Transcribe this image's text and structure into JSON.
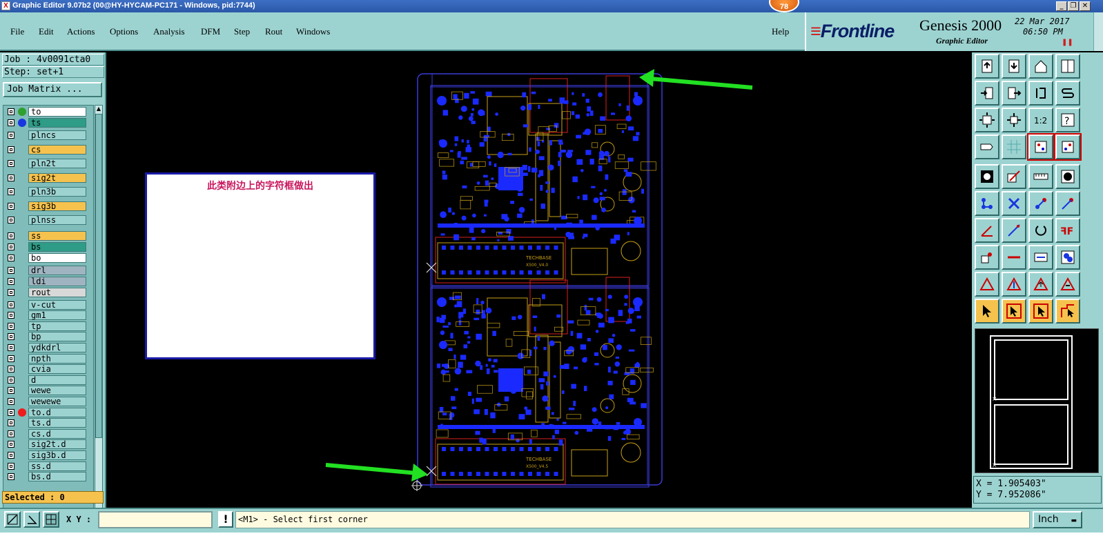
{
  "window": {
    "title": "Graphic Editor 9.07b2 (00@HY-HYCAM-PC171 - Windows, pid:7744)",
    "notification_count": "78",
    "minimize_glyph": "_",
    "restore_glyph": "❐",
    "close_glyph": "✕"
  },
  "menu": {
    "items": [
      "File",
      "Edit",
      "Actions",
      "Options",
      "Analysis",
      "DFM",
      "Step",
      "Rout",
      "Windows"
    ],
    "help": "Help"
  },
  "brand": {
    "logo": "Frontline",
    "product": "Genesis 2000",
    "subtitle": "Graphic Editor",
    "date": "22 Mar 2017",
    "time": "06:50 PM",
    "pause_glyph": "❚❚"
  },
  "info": {
    "job": "Job : 4v0091cta0",
    "step": "Step: set+1",
    "job_matrix": "Job Matrix ...",
    "selected": "Selected : 0"
  },
  "layers": [
    {
      "name": "to",
      "bg": "#ffffff",
      "dot": "#2ea02e"
    },
    {
      "name": "ts",
      "bg": "#2e9c86",
      "dot": "#1836e0"
    },
    {
      "name": "plncs",
      "bg": "#9cd3d1",
      "dot": ""
    },
    {
      "name": "cs",
      "bg": "#f6c24e",
      "dot": ""
    },
    {
      "name": "pln2t",
      "bg": "#9cd3d1",
      "dot": ""
    },
    {
      "name": "sig2t",
      "bg": "#f6c24e",
      "dot": ""
    },
    {
      "name": "pln3b",
      "bg": "#9cd3d1",
      "dot": ""
    },
    {
      "name": "sig3b",
      "bg": "#f6c24e",
      "dot": ""
    },
    {
      "name": "plnss",
      "bg": "#9cd3d1",
      "dot": ""
    },
    {
      "name": "ss",
      "bg": "#f6c24e",
      "dot": ""
    },
    {
      "name": "bs",
      "bg": "#2e9c86",
      "dot": ""
    },
    {
      "name": "bo",
      "bg": "#ffffff",
      "dot": ""
    },
    {
      "name": "drl",
      "bg": "#9fb4c0",
      "dot": ""
    },
    {
      "name": "ldi",
      "bg": "#9fb4c0",
      "dot": ""
    },
    {
      "name": "rout",
      "bg": "#d8d8d8",
      "dot": ""
    },
    {
      "name": "v-cut",
      "bg": "#9cd3d1",
      "dot": ""
    },
    {
      "name": "gm1",
      "bg": "#9cd3d1",
      "dot": ""
    },
    {
      "name": "tp",
      "bg": "#9cd3d1",
      "dot": ""
    },
    {
      "name": "bp",
      "bg": "#9cd3d1",
      "dot": ""
    },
    {
      "name": "ydkdrl",
      "bg": "#9cd3d1",
      "dot": ""
    },
    {
      "name": "npth",
      "bg": "#9cd3d1",
      "dot": ""
    },
    {
      "name": "cvia",
      "bg": "#9cd3d1",
      "dot": ""
    },
    {
      "name": "d",
      "bg": "#9cd3d1",
      "dot": ""
    },
    {
      "name": "wewe",
      "bg": "#9cd3d1",
      "dot": ""
    },
    {
      "name": "wewewe",
      "bg": "#9cd3d1",
      "dot": ""
    },
    {
      "name": "to.d",
      "bg": "#9cd3d1",
      "dot": "#ee1c1c"
    },
    {
      "name": "ts.d",
      "bg": "#9cd3d1",
      "dot": ""
    },
    {
      "name": "cs.d",
      "bg": "#9cd3d1",
      "dot": ""
    },
    {
      "name": "sig2t.d",
      "bg": "#9cd3d1",
      "dot": ""
    },
    {
      "name": "sig3b.d",
      "bg": "#9cd3d1",
      "dot": ""
    },
    {
      "name": "ss.d",
      "bg": "#9cd3d1",
      "dot": ""
    },
    {
      "name": "bs.d",
      "bg": "#9cd3d1",
      "dot": ""
    }
  ],
  "annotation": {
    "text": "此类附边上的字符框做出",
    "color": "#c8185f"
  },
  "pcb": {
    "labels": [
      "TECHBASE",
      "X500_V4.0",
      "TECHBASE",
      "X500_V4.5"
    ],
    "outline_color": "#3a3ad8",
    "pad_color": "#1a2aff",
    "trace_color": "#c8a018",
    "red_color": "#d82020",
    "arrow_color": "#22e022"
  },
  "coords": {
    "x": "X = 1.905403\"",
    "y": "Y = 7.952086\""
  },
  "bottom": {
    "xy_label": "X Y :",
    "xy_value": "",
    "alert": "!",
    "prompt": "<M1> - Select first corner",
    "units": "Inch",
    "units_dropdown": "▬"
  },
  "toolbar_icons": [
    "open-icon",
    "save-icon",
    "home-icon",
    "split-view-icon",
    "step-in-icon",
    "step-out-icon",
    "reset-icon",
    "redraw-icon",
    "fit-icon",
    "zoom-home-icon",
    "scale-1to2-icon",
    "help-icon",
    "measure-icon",
    "grid-icon",
    "layer-a-icon",
    "layer-b-icon",
    "pad-icon",
    "line-icon",
    "ruler-icon",
    "via-icon",
    "net-icon",
    "cross-icon",
    "connect-icon",
    "node-icon",
    "angle-icon",
    "arc-icon",
    "rotate-icon",
    "mirror-icon",
    "snap-icon",
    "minus-icon",
    "size-icon",
    "group-icon",
    "delta-icon",
    "arrow-a-icon",
    "arrow-b-icon",
    "arrow-c-icon",
    "select-icon",
    "select-box-icon",
    "select-rotate-icon",
    "select-poly-icon"
  ]
}
